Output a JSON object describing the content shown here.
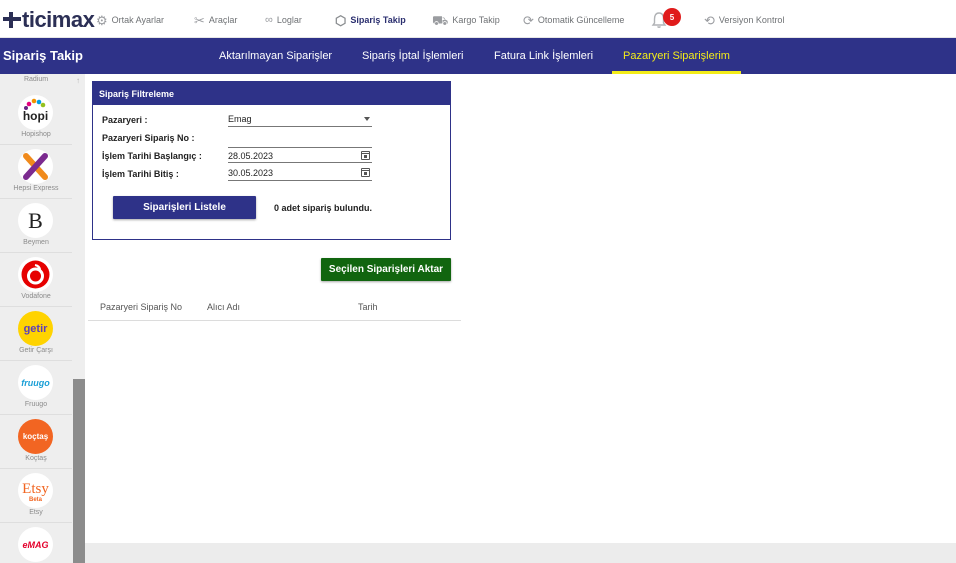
{
  "logo": {
    "text": "ticimax"
  },
  "top_nav": [
    {
      "label": "Ortak Ayarlar",
      "icon": "gear-icon",
      "active": false
    },
    {
      "label": "Araçlar",
      "icon": "tools-icon",
      "active": false
    },
    {
      "label": "Loglar",
      "icon": "link-icon",
      "active": false
    },
    {
      "label": "Sipariş Takip",
      "icon": "box-icon",
      "active": true
    },
    {
      "label": "Kargo Takip",
      "icon": "truck-icon",
      "active": false
    },
    {
      "label": "Otomatik Güncelleme",
      "icon": "sync-icon",
      "active": false
    },
    {
      "label": "Versiyon Kontrol",
      "icon": "refresh-icon",
      "active": false
    }
  ],
  "notifications": {
    "count": "5"
  },
  "subnav": {
    "title": "Sipariş Takip",
    "tabs": [
      {
        "label": "Aktarılmayan Siparişler",
        "active": false
      },
      {
        "label": "Sipariş İptal İşlemleri",
        "active": false
      },
      {
        "label": "Fatura Link İşlemleri",
        "active": false
      },
      {
        "label": "Pazaryeri Siparişlerim",
        "active": true
      }
    ]
  },
  "sidebar": {
    "header": "Radium",
    "items": [
      {
        "label": "Hopishop",
        "logo_text": "hopi",
        "color": "#222222"
      },
      {
        "label": "Hepsi Express",
        "logo_text": "X",
        "color": "#f08a1c"
      },
      {
        "label": "Beymen",
        "logo_text": "B",
        "color": "#222222"
      },
      {
        "label": "Vodafone",
        "logo_text": "",
        "color": "#e60000"
      },
      {
        "label": "Getir Çarşı",
        "logo_text": "getir",
        "color": "#5d3ebc"
      },
      {
        "label": "Fruugo",
        "logo_text": "fruugo",
        "color": "#1a9fd6"
      },
      {
        "label": "Koçtaş",
        "logo_text": "koçtaş",
        "color": "#f26522"
      },
      {
        "label": "Etsy",
        "logo_text": "Etsy",
        "sub_text": "Beta",
        "color": "#f16521"
      },
      {
        "label": "",
        "logo_text": "eMAG",
        "color": "#e4002b"
      }
    ]
  },
  "filter": {
    "title": "Sipariş Filtreleme",
    "marketplace_label": "Pazaryeri :",
    "marketplace_value": "Emag",
    "order_no_label": "Pazaryeri Sipariş No :",
    "start_label": "İşlem Tarihi Başlangıç :",
    "start_value": "28.05.2023",
    "end_label": "İşlem Tarihi Bitiş :",
    "end_value": "30.05.2023",
    "list_button": "Siparişleri Listele",
    "result_text": "0 adet sipariş bulundu."
  },
  "transfer_button": "Seçilen Siparişleri Aktar",
  "table": {
    "columns": [
      "Pazaryeri Sipariş No",
      "Alıcı Adı",
      "Tarih"
    ]
  }
}
